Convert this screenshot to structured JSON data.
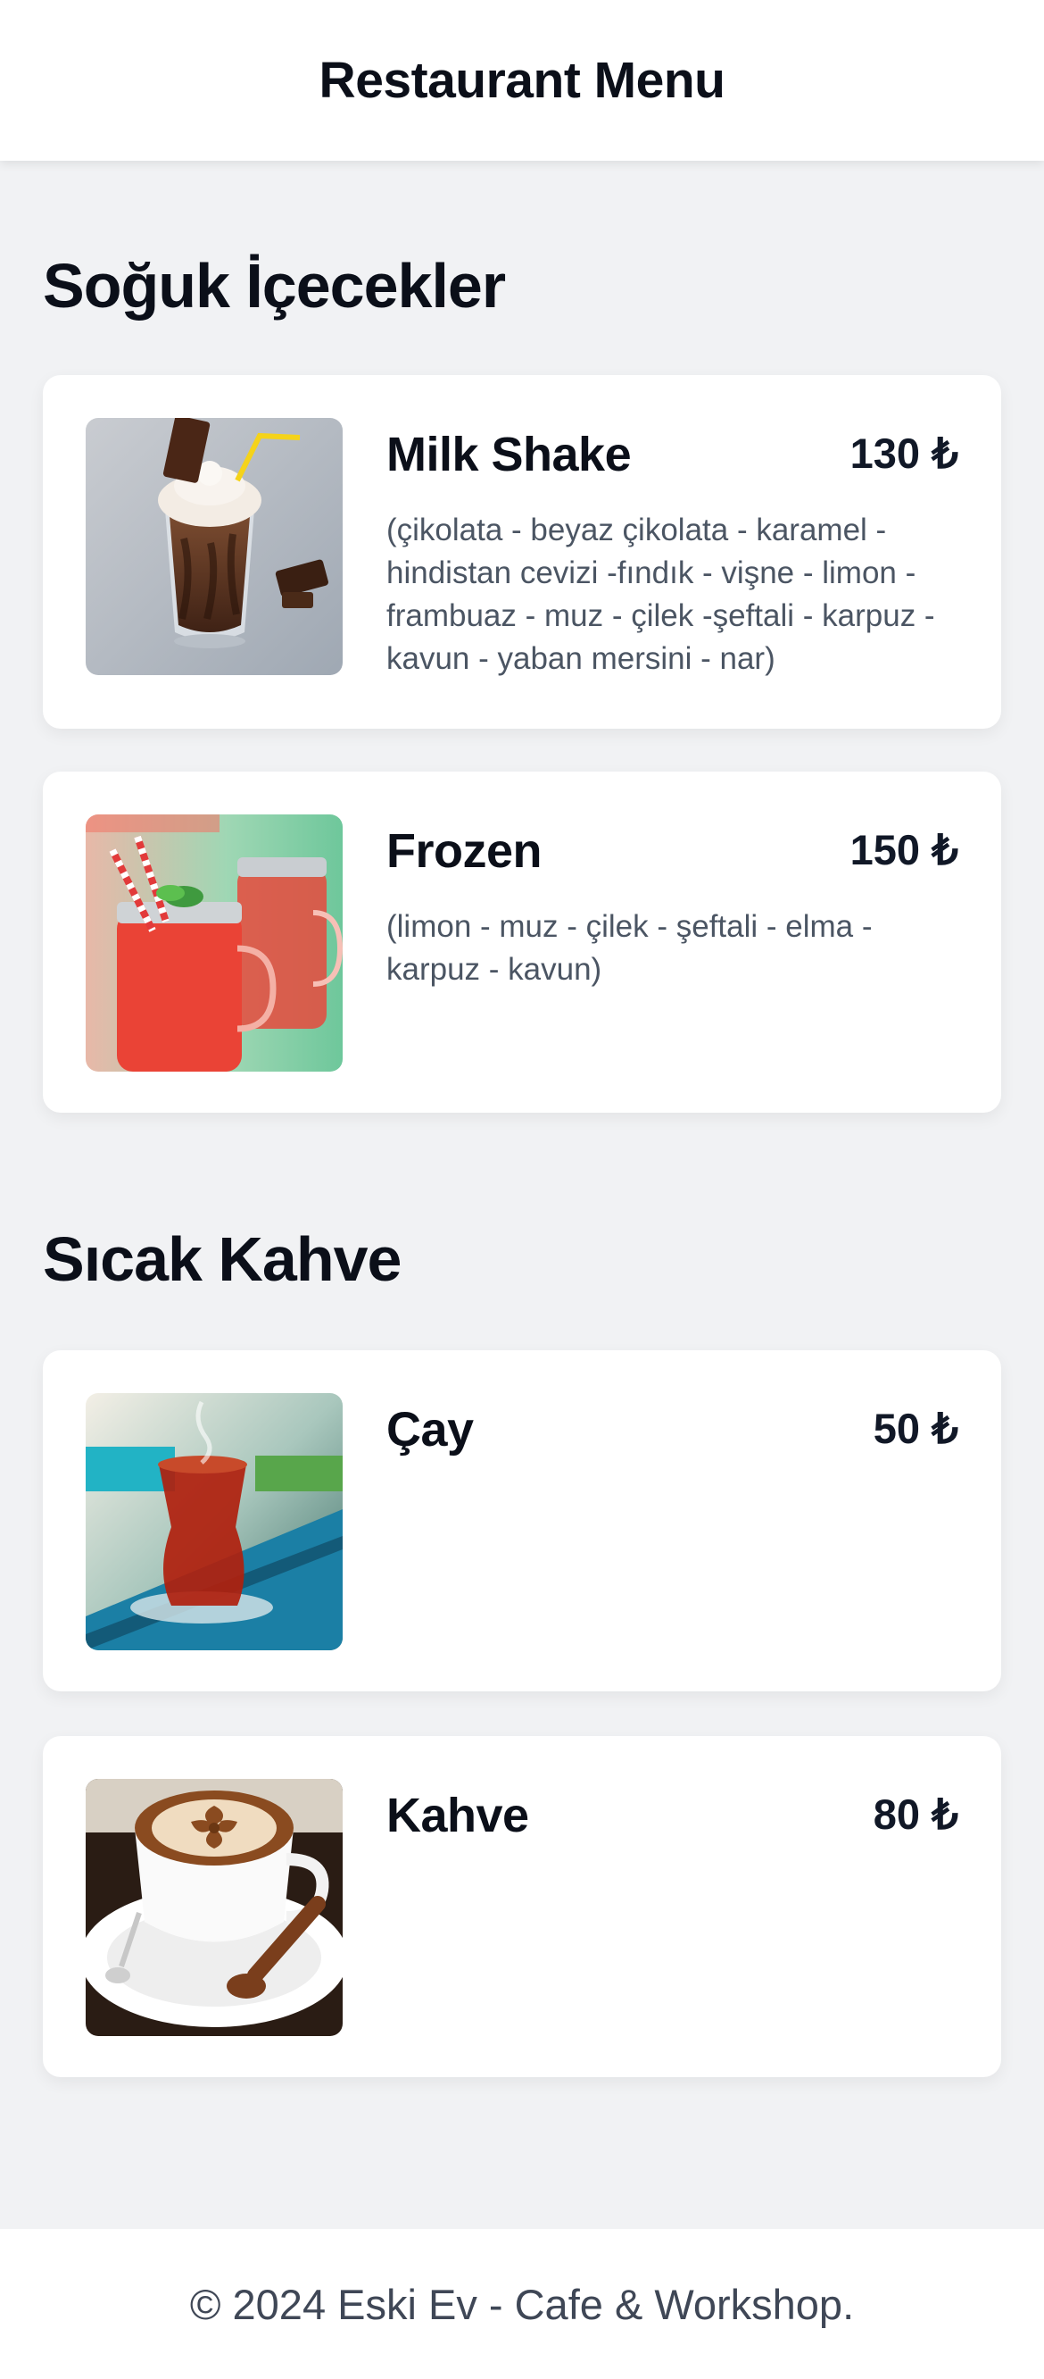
{
  "header": {
    "title": "Restaurant Menu"
  },
  "sections": [
    {
      "title": "Soğuk İçecekler",
      "items": [
        {
          "name": "Milk Shake",
          "price": "130 ₺",
          "description": "(çikolata - beyaz çikolata - karamel - hindistan cevizi -fındık - vişne - limon - frambuaz - muz - çilek -şeftali - karpuz - kavun - yaban mersini - nar)",
          "image": "milkshake-photo"
        },
        {
          "name": "Frozen",
          "price": "150 ₺",
          "description": "(limon - muz - çilek - şeftali - elma - karpuz - kavun)",
          "image": "frozen-drink-photo"
        }
      ]
    },
    {
      "title": "Sıcak Kahve",
      "items": [
        {
          "name": "Çay",
          "price": "50 ₺",
          "description": "",
          "image": "tea-glass-photo"
        },
        {
          "name": "Kahve",
          "price": "80 ₺",
          "description": "",
          "image": "latte-cup-photo"
        }
      ]
    }
  ],
  "footer": {
    "text": "© 2024 Eski Ev - Cafe & Workshop."
  }
}
